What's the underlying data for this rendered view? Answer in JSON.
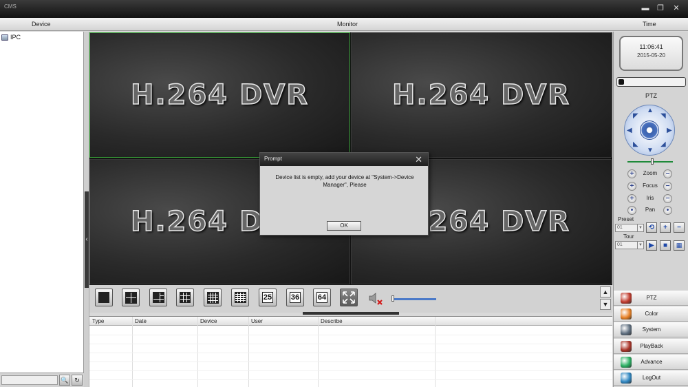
{
  "window": {
    "title": "CMS",
    "minimize": "▬",
    "restore": "❐",
    "close": "✕"
  },
  "headers": {
    "device": "Device",
    "monitor": "Monitor",
    "time": "Time"
  },
  "device_tree": {
    "root_label": "IPC"
  },
  "device_search": {
    "placeholder": "",
    "search_icon": "🔍",
    "refresh_icon": "↻"
  },
  "monitor": {
    "cell_logo": "H.264 DVR",
    "cells": 4,
    "active_cell": 0
  },
  "prompt": {
    "title": "Prompt",
    "message": "Device list is empty, add your device at \"System->Device Manager\", Please",
    "ok_label": "OK",
    "close_glyph": "✕"
  },
  "layout_toolbar": {
    "number_buttons": [
      "25",
      "36",
      "64"
    ],
    "volume_fraction": 0.02,
    "scroll_up": "▲",
    "scroll_down": "▼"
  },
  "log_table": {
    "columns": [
      "Type",
      "Date",
      "Device",
      "User",
      "Describe"
    ],
    "rows": []
  },
  "clock": {
    "time": "11:06:41",
    "date": "2015-05-20"
  },
  "progress_fraction": 0.08,
  "ptz": {
    "label": "PTZ",
    "speed_fraction": 0.55,
    "controls": [
      "Zoom",
      "Focus",
      "Iris",
      "Pan"
    ],
    "preset_label": "Preset",
    "preset_value": "01",
    "tour_label": "Tour",
    "tour_value": "01"
  },
  "menu": [
    {
      "label": "PTZ",
      "icon": "ptz-icon",
      "color": "#c0392b"
    },
    {
      "label": "Color",
      "icon": "color-icon",
      "color": "#e67e22"
    },
    {
      "label": "System",
      "icon": "system-icon",
      "color": "#5d6d7e"
    },
    {
      "label": "PlayBack",
      "icon": "playback-icon",
      "color": "#a93226"
    },
    {
      "label": "Advance",
      "icon": "advance-icon",
      "color": "#27ae60"
    },
    {
      "label": "LogOut",
      "icon": "logout-icon",
      "color": "#2e86c1"
    }
  ]
}
